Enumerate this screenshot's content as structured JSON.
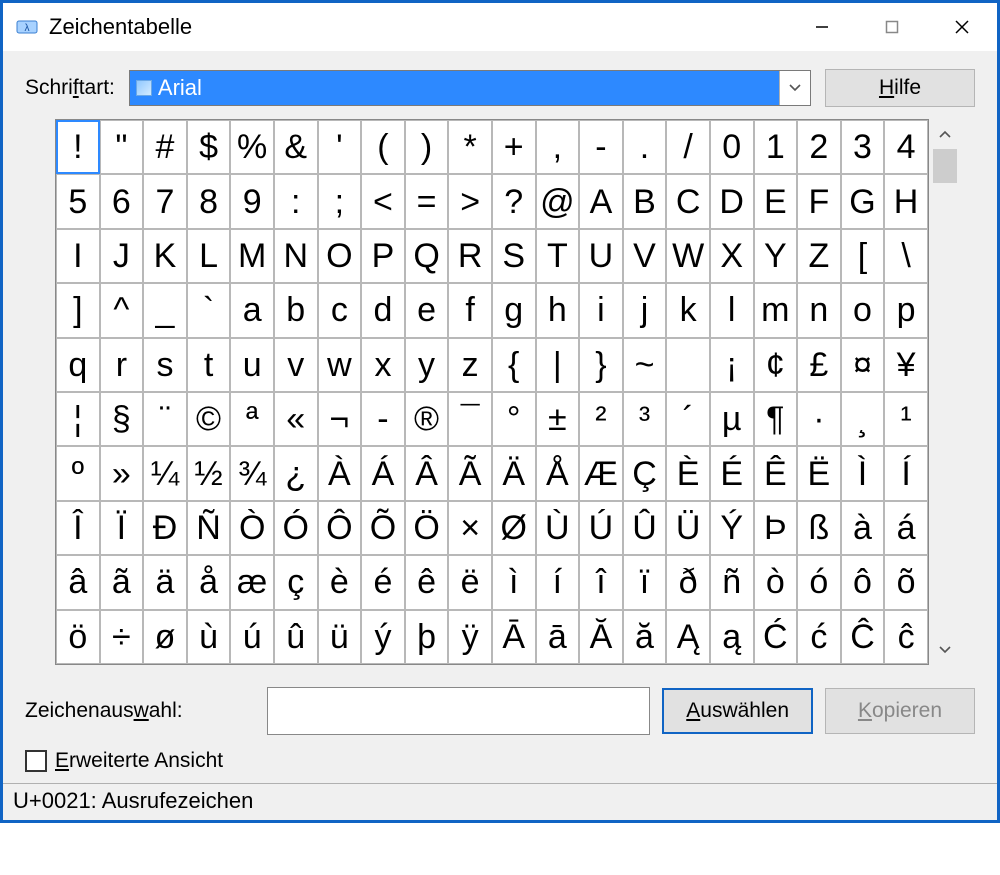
{
  "window": {
    "title": "Zeichentabelle"
  },
  "font": {
    "label_pre": "Schri",
    "label_u": "f",
    "label_post": "tart:",
    "selected": "Arial"
  },
  "help": {
    "pre": "",
    "u": "H",
    "post": "ilfe"
  },
  "characters": [
    "!",
    "\"",
    "#",
    "$",
    "%",
    "&",
    "'",
    "(",
    ")",
    "*",
    "+",
    ",",
    "-",
    ".",
    "/",
    "0",
    "1",
    "2",
    "3",
    "4",
    "5",
    "6",
    "7",
    "8",
    "9",
    ":",
    ";",
    "<",
    "=",
    ">",
    "?",
    "@",
    "A",
    "B",
    "C",
    "D",
    "E",
    "F",
    "G",
    "H",
    "I",
    "J",
    "K",
    "L",
    "M",
    "N",
    "O",
    "P",
    "Q",
    "R",
    "S",
    "T",
    "U",
    "V",
    "W",
    "X",
    "Y",
    "Z",
    "[",
    "\\",
    "]",
    "^",
    "_",
    "`",
    "a",
    "b",
    "c",
    "d",
    "e",
    "f",
    "g",
    "h",
    "i",
    "j",
    "k",
    "l",
    "m",
    "n",
    "o",
    "p",
    "q",
    "r",
    "s",
    "t",
    "u",
    "v",
    "w",
    "x",
    "y",
    "z",
    "{",
    "|",
    "}",
    "~",
    "",
    "¡",
    "¢",
    "£",
    "¤",
    "¥",
    "¦",
    "§",
    "¨",
    "©",
    "ª",
    "«",
    "¬",
    "­-",
    "®",
    "¯",
    "°",
    "±",
    "²",
    "³",
    "´",
    "µ",
    "¶",
    "·",
    "¸",
    "¹",
    "º",
    "»",
    "¼",
    "½",
    "¾",
    "¿",
    "À",
    "Á",
    "Â",
    "Ã",
    "Ä",
    "Å",
    "Æ",
    "Ç",
    "È",
    "É",
    "Ê",
    "Ë",
    "Ì",
    "Í",
    "Î",
    "Ï",
    "Ð",
    "Ñ",
    "Ò",
    "Ó",
    "Ô",
    "Õ",
    "Ö",
    "×",
    "Ø",
    "Ù",
    "Ú",
    "Û",
    "Ü",
    "Ý",
    "Þ",
    "ß",
    "à",
    "á",
    "â",
    "ã",
    "ä",
    "å",
    "æ",
    "ç",
    "è",
    "é",
    "ê",
    "ë",
    "ì",
    "í",
    "î",
    "ï",
    "ð",
    "ñ",
    "ò",
    "ó",
    "ô",
    "õ",
    "ö",
    "÷",
    "ø",
    "ù",
    "ú",
    "û",
    "ü",
    "ý",
    "þ",
    "ÿ",
    "Ā",
    "ā",
    "Ă",
    "ă",
    "Ą",
    "ą",
    "Ć",
    "ć",
    "Ĉ",
    "ĉ"
  ],
  "selected_index": 0,
  "selection": {
    "label_pre": "Zeichenaus",
    "label_u": "w",
    "label_post": "ahl:",
    "value": ""
  },
  "buttons": {
    "select": {
      "pre": "",
      "u": "A",
      "post": "uswählen"
    },
    "copy": {
      "pre": "",
      "u": "K",
      "post": "opieren"
    }
  },
  "advanced": {
    "pre": "",
    "u": "E",
    "post": "rweiterte Ansicht",
    "checked": false
  },
  "status": "U+0021: Ausrufezeichen"
}
